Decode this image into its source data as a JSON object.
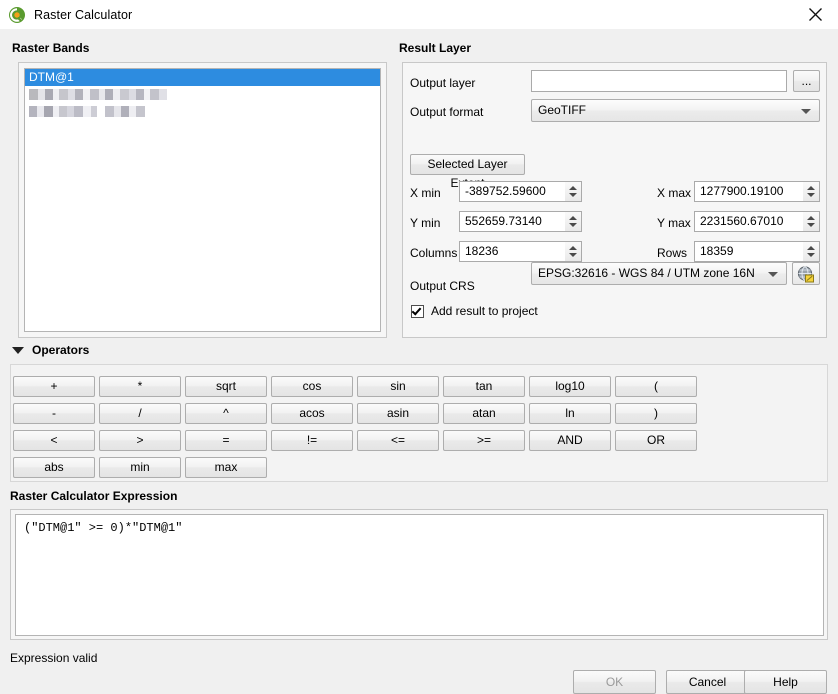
{
  "window": {
    "title": "Raster Calculator",
    "icon": "qgis-logo-icon",
    "close_label": "×"
  },
  "raster_bands": {
    "group_title": "Raster Bands",
    "items": [
      {
        "label": "DTM@1",
        "selected": true,
        "redacted": false
      },
      {
        "label": "",
        "selected": false,
        "redacted": true
      },
      {
        "label": "",
        "selected": false,
        "redacted": true
      }
    ]
  },
  "result_layer": {
    "group_title": "Result Layer",
    "output_layer": {
      "label": "Output layer",
      "value": "",
      "placeholder": ""
    },
    "browse_button": "...",
    "output_format": {
      "label": "Output format",
      "value": "GeoTIFF"
    },
    "selected_layer_extent_button": "Selected Layer Extent",
    "extent": {
      "x_min": {
        "label": "X min",
        "value": "-389752.59600"
      },
      "x_max": {
        "label": "X max",
        "value": "1277900.19100"
      },
      "y_min": {
        "label": "Y min",
        "value": "552659.73140"
      },
      "y_max": {
        "label": "Y max",
        "value": "2231560.67010"
      },
      "columns": {
        "label": "Columns",
        "value": "18236"
      },
      "rows": {
        "label": "Rows",
        "value": "18359"
      }
    },
    "output_crs": {
      "label": "Output CRS",
      "value": "EPSG:32616 - WGS 84 / UTM zone 16N",
      "select_button_icon": "globe-crs-icon"
    },
    "add_result_to_project": {
      "label": "Add result to project",
      "checked": true
    }
  },
  "operators": {
    "group_title": "Operators",
    "expanded": true,
    "buttons": [
      "+",
      "*",
      "sqrt",
      "cos",
      "sin",
      "tan",
      "log10",
      "(",
      "-",
      "/",
      "^",
      "acos",
      "asin",
      "atan",
      "ln",
      ")",
      "<",
      ">",
      "=",
      "!=",
      "<=",
      ">=",
      "AND",
      "OR",
      "abs",
      "min",
      "max"
    ]
  },
  "expression": {
    "group_title": "Raster Calculator Expression",
    "value": "(\"DTM@1\" >= 0)*\"DTM@1\""
  },
  "status": {
    "text": "Expression valid"
  },
  "footer": {
    "ok": {
      "label": "OK",
      "enabled": false
    },
    "cancel": {
      "label": "Cancel",
      "enabled": true
    },
    "help": {
      "label": "Help",
      "enabled": true
    }
  },
  "colors": {
    "selection_blue": "#2d8ce0",
    "dialog_bg": "#f0f0f0",
    "qgis_green": "#589632"
  }
}
